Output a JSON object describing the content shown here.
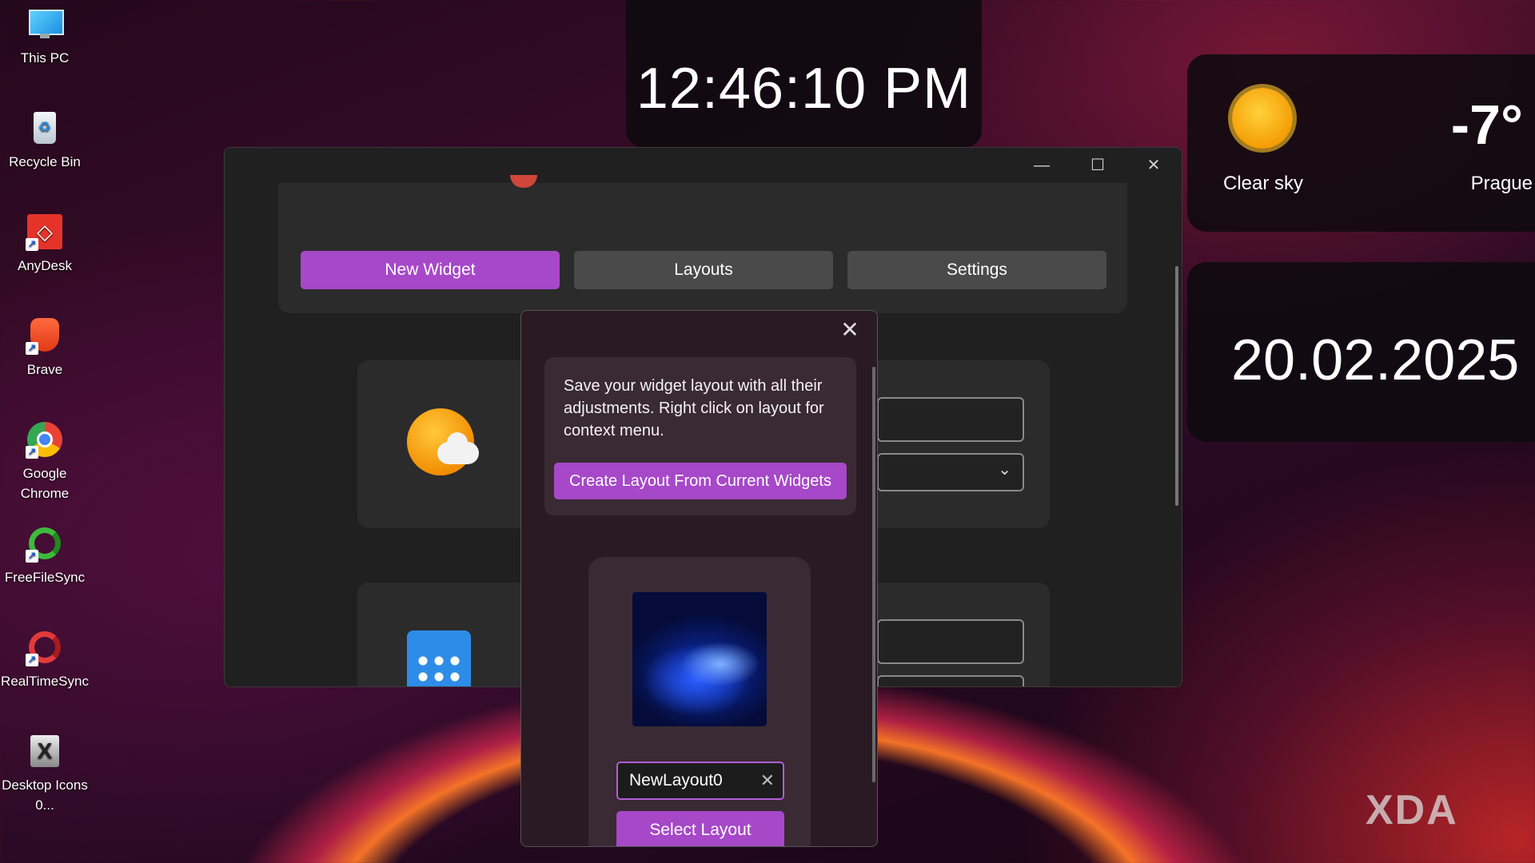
{
  "desktop": {
    "icons": [
      {
        "label": "This PC",
        "icon": "monitor-icon"
      },
      {
        "label": "Recycle Bin",
        "icon": "recycle-bin-icon"
      },
      {
        "label": "AnyDesk",
        "icon": "anydesk-icon"
      },
      {
        "label": "Brave",
        "icon": "brave-icon"
      },
      {
        "label": "Google Chrome",
        "icon": "chrome-icon"
      },
      {
        "label": "FreeFileSync",
        "icon": "freefilesync-icon"
      },
      {
        "label": "RealTimeSync",
        "icon": "realtimesync-icon"
      },
      {
        "label": "Desktop Icons 0...",
        "icon": "desktop-icons-icon"
      }
    ]
  },
  "clock": {
    "time": "12:46:10 PM"
  },
  "weather": {
    "condition": "Clear sky",
    "temperature": "-7°",
    "city": "Prague",
    "icon": "sun-icon"
  },
  "date_widget": {
    "date": "20.02.2025"
  },
  "main_window": {
    "tabs": {
      "new_widget": "New Widget",
      "layouts": "Layouts",
      "settings": "Settings"
    },
    "caption": {
      "minimize": "—",
      "maximize": "☐",
      "close": "✕"
    },
    "accent_color": "#a648c8"
  },
  "dialog": {
    "close": "✕",
    "info_text": "Save your widget layout with all their adjustments. Right click on layout for context menu.",
    "create_button": "Create Layout From Current Widgets",
    "layout_name_value": "NewLayout0",
    "clear": "✕",
    "select_button": "Select Layout"
  },
  "watermark": "XDA"
}
